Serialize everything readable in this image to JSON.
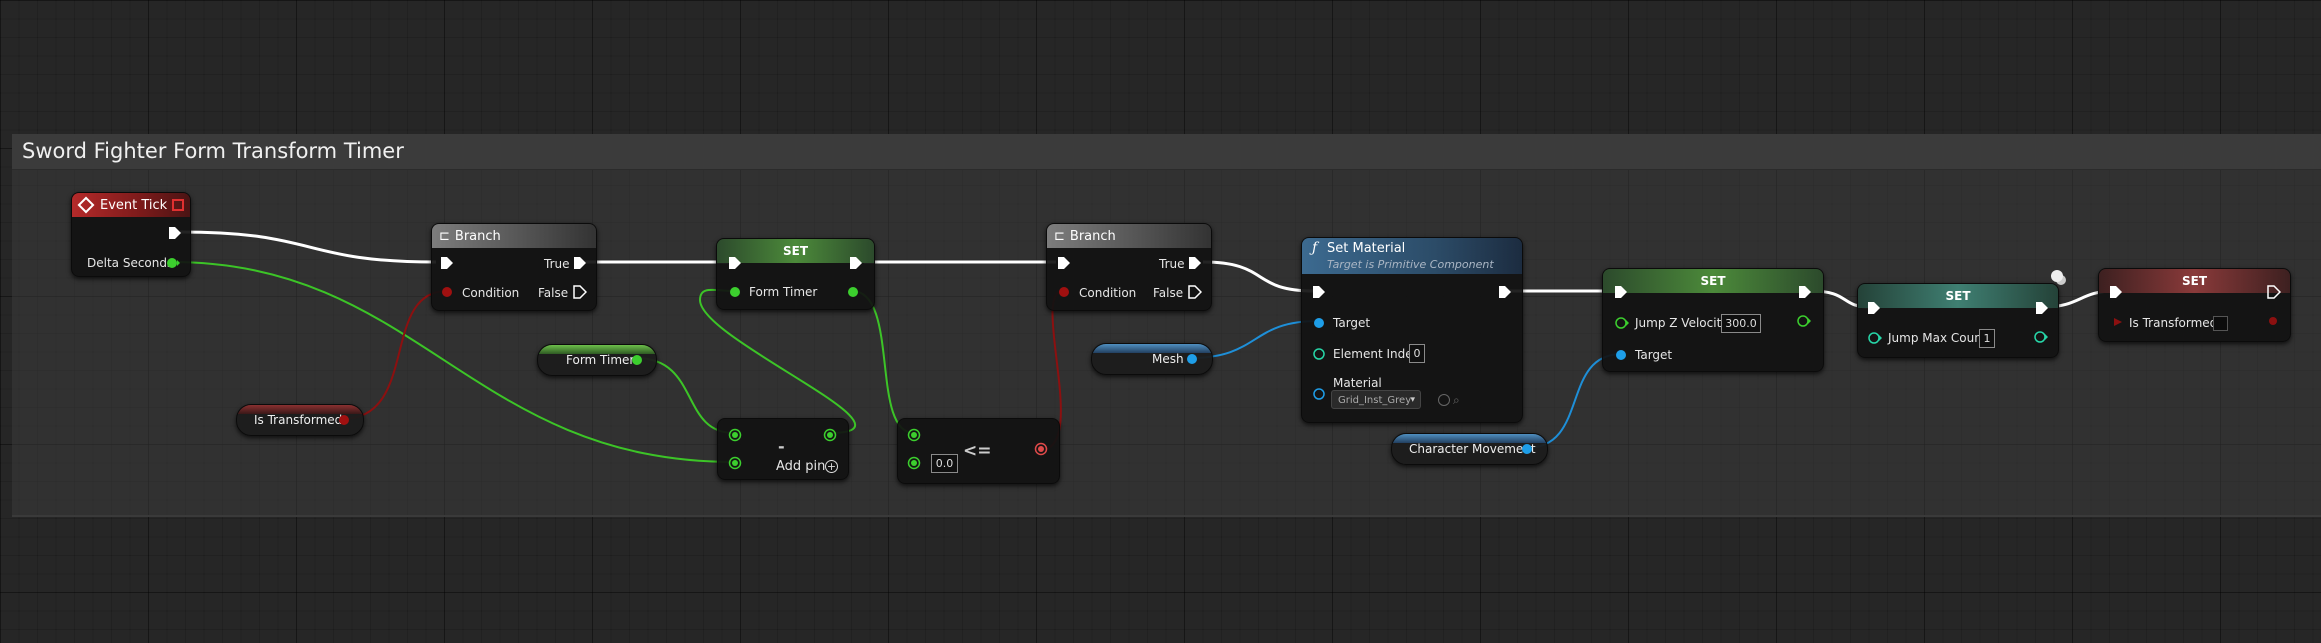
{
  "comment": {
    "title": "Sword Fighter Form Transform Timer"
  },
  "nodes": {
    "event_tick": {
      "title": "Event Tick",
      "delta_label": "Delta Seconds"
    },
    "branch1": {
      "title": "Branch",
      "true_label": "True",
      "false_label": "False",
      "condition_label": "Condition"
    },
    "set_form_timer": {
      "title": "SET",
      "pin_label": "Form Timer"
    },
    "form_timer_getter": {
      "label": "Form Timer"
    },
    "is_transformed_getter": {
      "label": "Is Transformed"
    },
    "subtract": {
      "symbol": "-",
      "add_pin_label": "Add pin"
    },
    "compare": {
      "symbol": "<=",
      "value": "0.0"
    },
    "branch2": {
      "title": "Branch",
      "true_label": "True",
      "false_label": "False",
      "condition_label": "Condition"
    },
    "set_material": {
      "title": "Set Material",
      "subtitle": "Target is Primitive Component",
      "target_label": "Target",
      "element_index_label": "Element Index",
      "element_index_value": "0",
      "material_label": "Material",
      "material_value": "Grid_Inst_Grey"
    },
    "mesh_getter": {
      "label": "Mesh"
    },
    "character_movement_getter": {
      "label": "Character Movement"
    },
    "set_jump_z": {
      "title": "SET",
      "pin_label": "Jump Z Velocity",
      "value": "300.0",
      "target_label": "Target"
    },
    "set_jump_max": {
      "title": "SET",
      "pin_label": "Jump Max Count",
      "value": "1"
    },
    "set_is_transformed": {
      "title": "SET",
      "pin_label": "Is Transformed"
    }
  },
  "colors": {
    "exec_wire": "#ffffff",
    "float_pin": "#3ccf2e",
    "bool_pin": "#8c0d0d",
    "object_pin": "#1e9ee8",
    "int_pin": "#27d6a8",
    "wildcard_red": "#e04a4a"
  },
  "icons": {
    "event": "event-diamond-icon",
    "branch": "branch-icon",
    "function": "function-icon"
  }
}
